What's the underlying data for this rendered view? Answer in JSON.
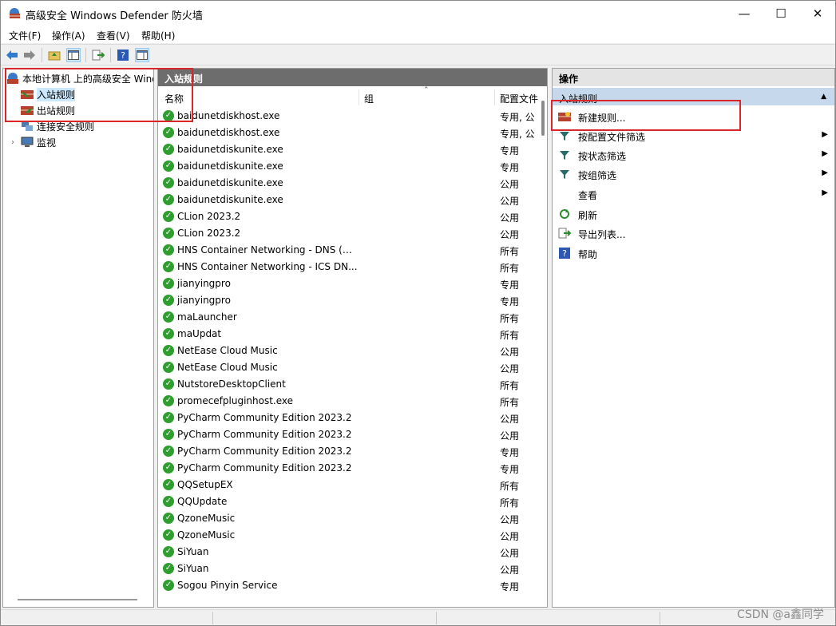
{
  "window": {
    "title": "高级安全 Windows Defender 防火墙"
  },
  "menu": [
    "文件(F)",
    "操作(A)",
    "查看(V)",
    "帮助(H)"
  ],
  "tree": {
    "root": "本地计算机 上的高级安全 Wind",
    "items": [
      "入站规则",
      "出站规则",
      "连接安全规则",
      "监视"
    ]
  },
  "list": {
    "header": "入站规则",
    "columns": {
      "name": "名称",
      "group": "组",
      "profile": "配置文件"
    },
    "rows": [
      {
        "name": "baidunetdiskhost.exe",
        "profile": "专用, 公"
      },
      {
        "name": "baidunetdiskhost.exe",
        "profile": "专用, 公"
      },
      {
        "name": "baidunetdiskunite.exe",
        "profile": "专用"
      },
      {
        "name": "baidunetdiskunite.exe",
        "profile": "专用"
      },
      {
        "name": "baidunetdiskunite.exe",
        "profile": "公用"
      },
      {
        "name": "baidunetdiskunite.exe",
        "profile": "公用"
      },
      {
        "name": "CLion 2023.2",
        "profile": "公用"
      },
      {
        "name": "CLion 2023.2",
        "profile": "公用"
      },
      {
        "name": "HNS Container Networking - DNS (U...",
        "profile": "所有"
      },
      {
        "name": "HNS Container Networking - ICS DN...",
        "profile": "所有"
      },
      {
        "name": "jianyingpro",
        "profile": "专用"
      },
      {
        "name": "jianyingpro",
        "profile": "专用"
      },
      {
        "name": "maLauncher",
        "profile": "所有"
      },
      {
        "name": "maUpdat",
        "profile": "所有"
      },
      {
        "name": "NetEase Cloud Music",
        "profile": "公用"
      },
      {
        "name": "NetEase Cloud Music",
        "profile": "公用"
      },
      {
        "name": "NutstoreDesktopClient",
        "profile": "所有"
      },
      {
        "name": "promecefpluginhost.exe",
        "profile": "所有"
      },
      {
        "name": "PyCharm Community Edition 2023.2",
        "profile": "公用"
      },
      {
        "name": "PyCharm Community Edition 2023.2",
        "profile": "公用"
      },
      {
        "name": "PyCharm Community Edition 2023.2",
        "profile": "专用"
      },
      {
        "name": "PyCharm Community Edition 2023.2",
        "profile": "专用"
      },
      {
        "name": "QQSetupEX",
        "profile": "所有"
      },
      {
        "name": "QQUpdate",
        "profile": "所有"
      },
      {
        "name": "QzoneMusic",
        "profile": "公用"
      },
      {
        "name": "QzoneMusic",
        "profile": "公用"
      },
      {
        "name": "SiYuan",
        "profile": "公用"
      },
      {
        "name": "SiYuan",
        "profile": "公用"
      },
      {
        "name": "Sogou Pinyin Service",
        "profile": "专用"
      }
    ]
  },
  "actions": {
    "header": "操作",
    "group": "入站规则",
    "items": [
      {
        "label": "新建规则...",
        "icon": "new-rule-icon",
        "submenu": false
      },
      {
        "label": "按配置文件筛选",
        "icon": "filter-icon",
        "submenu": true
      },
      {
        "label": "按状态筛选",
        "icon": "filter-icon",
        "submenu": true
      },
      {
        "label": "按组筛选",
        "icon": "filter-icon",
        "submenu": true
      },
      {
        "label": "查看",
        "icon": "",
        "submenu": true
      },
      {
        "label": "刷新",
        "icon": "refresh-icon",
        "submenu": false
      },
      {
        "label": "导出列表...",
        "icon": "export-icon",
        "submenu": false
      },
      {
        "label": "帮助",
        "icon": "help-icon",
        "submenu": false
      }
    ]
  },
  "watermark": "CSDN @a鑫同学",
  "colors": {
    "accent_highlight": "#d9262b",
    "check_green": "#2e9e2e",
    "selected_bg": "#cce8ff",
    "group_bg": "#c6d9ec"
  }
}
